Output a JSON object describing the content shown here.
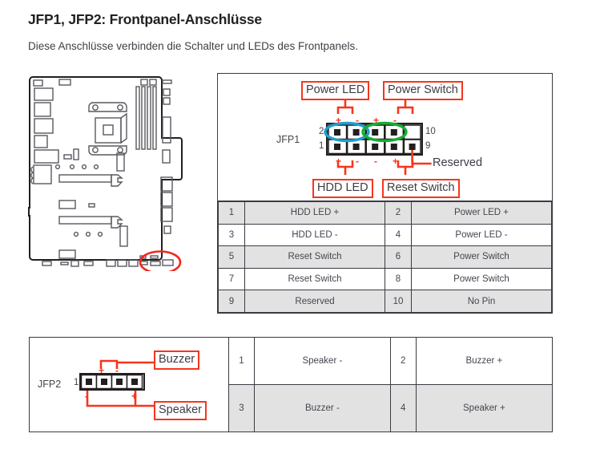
{
  "header": {
    "title": "JFP1, JFP2: Frontpanel-Anschlüsse",
    "subtitle": "Diese Anschlüsse verbinden die Schalter und LEDs des Frontpanels."
  },
  "motherboard": {
    "highlight_color": "#ef2a1c",
    "outline_color": "#231f20"
  },
  "jfp1": {
    "connector_label": "JFP1",
    "callouts": {
      "top_left": "Power LED",
      "top_right": "Power Switch",
      "bottom_left": "HDD LED",
      "bottom_right": "Reset Switch",
      "reserved": "Reserved"
    },
    "pin_markers": {
      "top_left_num": "2",
      "bottom_left_num": "1",
      "top_right_num": "10",
      "bottom_right_num": "9"
    },
    "polarity_top": [
      "+",
      "-",
      "+",
      "-"
    ],
    "polarity_bottom": [
      "+",
      "-",
      "-",
      "+"
    ],
    "highlight_blue": "#1f9fd0",
    "highlight_green": "#13ae34",
    "accent_red": "#f4361e",
    "rows": [
      {
        "n1": "1",
        "v1": "HDD LED +",
        "n2": "2",
        "v2": "Power LED +",
        "shaded": true
      },
      {
        "n1": "3",
        "v1": "HDD LED -",
        "n2": "4",
        "v2": "Power LED -",
        "shaded": false
      },
      {
        "n1": "5",
        "v1": "Reset Switch",
        "n2": "6",
        "v2": "Power Switch",
        "shaded": true
      },
      {
        "n1": "7",
        "v1": "Reset Switch",
        "n2": "8",
        "v2": "Power Switch",
        "shaded": false
      },
      {
        "n1": "9",
        "v1": "Reserved",
        "n2": "10",
        "v2": "No Pin",
        "shaded": true
      }
    ]
  },
  "jfp2": {
    "connector_label": "JFP2",
    "callouts": {
      "top": "Buzzer",
      "bottom": "Speaker"
    },
    "pin_markers": {
      "first_pin": "1"
    },
    "polarity_top": [
      "+",
      "-"
    ],
    "polarity_bottom": [
      "-",
      "+"
    ],
    "rows": [
      {
        "n1": "1",
        "v1": "Speaker -",
        "n2": "2",
        "v2": "Buzzer +",
        "shaded": false
      },
      {
        "n1": "3",
        "v1": "Buzzer -",
        "n2": "4",
        "v2": "Speaker +",
        "shaded": true
      }
    ]
  }
}
